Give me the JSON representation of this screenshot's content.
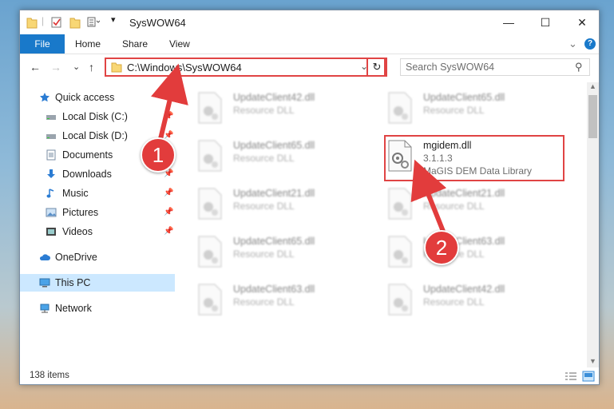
{
  "window": {
    "title": "SysWOW64",
    "minimize_glyph": "—",
    "maximize_glyph": "☐",
    "close_glyph": "✕"
  },
  "ribbon": {
    "tabs": [
      {
        "label": "File"
      },
      {
        "label": "Home"
      },
      {
        "label": "Share"
      },
      {
        "label": "View"
      }
    ],
    "expand_glyph": "⌄",
    "help_glyph": "?"
  },
  "navigation": {
    "back_glyph": "←",
    "forward_glyph": "→",
    "recent_glyph": "⌄",
    "up_glyph": "↑",
    "address": "C:\\Windows\\SysWOW64",
    "address_dropdown_glyph": "⌄",
    "refresh_glyph": "↻",
    "search_placeholder": "Search SysWOW64",
    "search_glyph": "⚲"
  },
  "nav_pane": {
    "items": [
      {
        "label": "Quick access",
        "icon": "star-icon",
        "pinned": false
      },
      {
        "label": "Local Disk (C:)",
        "icon": "drive-icon",
        "pinned": true
      },
      {
        "label": "Local Disk (D:)",
        "icon": "drive-icon",
        "pinned": true
      },
      {
        "label": "Documents",
        "icon": "documents-icon",
        "pinned": true
      },
      {
        "label": "Downloads",
        "icon": "download-icon",
        "pinned": true
      },
      {
        "label": "Music",
        "icon": "music-icon",
        "pinned": true
      },
      {
        "label": "Pictures",
        "icon": "pictures-icon",
        "pinned": true
      },
      {
        "label": "Videos",
        "icon": "videos-icon",
        "pinned": true
      },
      {
        "label": "OneDrive",
        "icon": "cloud-icon",
        "pinned": false
      },
      {
        "label": "This PC",
        "icon": "computer-icon",
        "pinned": false,
        "selected": true
      },
      {
        "label": "Network",
        "icon": "network-icon",
        "pinned": false
      }
    ],
    "pin_glyph": "📌"
  },
  "files": [
    {
      "name": "UpdateClient42.dll",
      "type": "Resource DLL"
    },
    {
      "name": "UpdateClient65.dll",
      "type": "Resource DLL"
    },
    {
      "name": "UpdateClient65.dll",
      "type": "Resource DLL"
    },
    {
      "name": "mgidem.dll",
      "version": "3.1.1.3",
      "description": "MaGIS DEM Data Library",
      "highlighted": true
    },
    {
      "name": "UpdateClient21.dll",
      "type": "Resource DLL"
    },
    {
      "name": "UpdateClient21.dll",
      "type": "Resource DLL"
    },
    {
      "name": "UpdateClient65.dll",
      "type": "Resource DLL"
    },
    {
      "name": "UpdateClient63.dll",
      "type": "Resource DLL"
    },
    {
      "name": "UpdateClient63.dll",
      "type": "Resource DLL"
    },
    {
      "name": "UpdateClient42.dll",
      "type": "Resource DLL"
    }
  ],
  "status": {
    "item_count": "138 items"
  },
  "callouts": {
    "one": "1",
    "two": "2",
    "color": "#e23c3c"
  }
}
